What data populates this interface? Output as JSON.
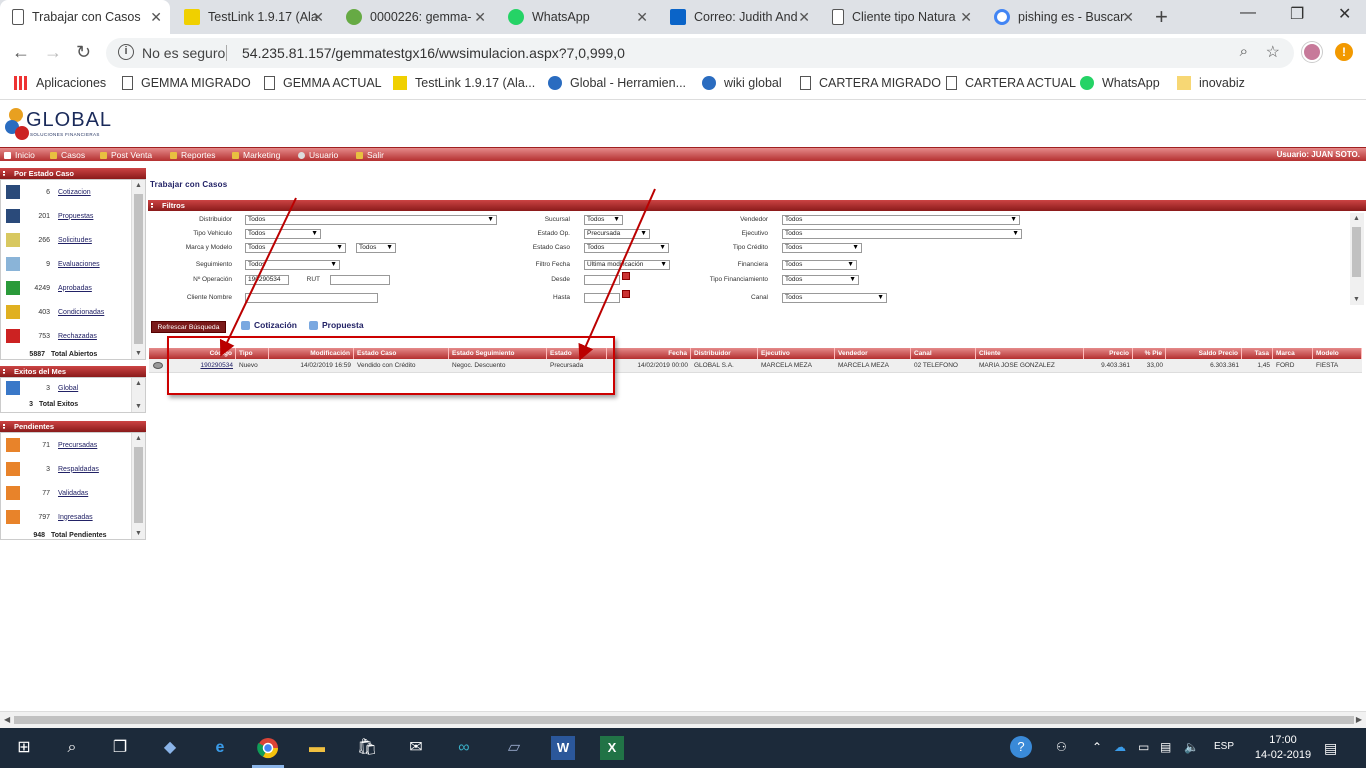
{
  "browser": {
    "tabs": [
      {
        "title": "Trabajar con Casos",
        "active": true,
        "icon": "page-icon"
      },
      {
        "title": "TestLink 1.9.17 (Ala",
        "icon": "testlink-icon"
      },
      {
        "title": "0000226: gemma-",
        "icon": "mantis-icon"
      },
      {
        "title": "WhatsApp",
        "icon": "whatsapp-icon"
      },
      {
        "title": "Correo: Judith And",
        "icon": "outlook-icon"
      },
      {
        "title": "Cliente tipo Natura",
        "icon": "page-icon"
      },
      {
        "title": "pishing es - Buscar",
        "icon": "google-icon"
      }
    ],
    "security_label": "No es seguro",
    "url": "54.235.81.157/gemmatestgx16/wwsimulacion.aspx?7,0,999,0",
    "bookmarks": [
      {
        "label": "Aplicaciones",
        "icon": "apps-icon"
      },
      {
        "label": "GEMMA MIGRADO",
        "icon": "page-icon"
      },
      {
        "label": "GEMMA ACTUAL",
        "icon": "page-icon"
      },
      {
        "label": "TestLink 1.9.17 (Ala...",
        "icon": "testlink-icon"
      },
      {
        "label": "Global - Herramien...",
        "icon": "global-icon"
      },
      {
        "label": "wiki global",
        "icon": "global-icon"
      },
      {
        "label": "CARTERA MIGRADO",
        "icon": "page-icon"
      },
      {
        "label": "CARTERA ACTUAL",
        "icon": "page-icon"
      },
      {
        "label": "WhatsApp",
        "icon": "whatsapp-icon"
      },
      {
        "label": "inovabiz",
        "icon": "folder-icon"
      }
    ]
  },
  "app": {
    "logo_text": "GLOBAL",
    "logo_sub": "SOLUCIONES FINANCIERAS",
    "menu": [
      "Inicio",
      "Casos",
      "Post Venta",
      "Reportes",
      "Marketing",
      "Usuario",
      "Salir"
    ],
    "user_label": "Usuario: JUAN SOTO."
  },
  "sidebar": {
    "por_estado": {
      "title": "Por Estado Caso",
      "items": [
        {
          "count": "6",
          "label": "Cotizacion"
        },
        {
          "count": "201",
          "label": "Propuestas"
        },
        {
          "count": "266",
          "label": "Solicitudes"
        },
        {
          "count": "9",
          "label": "Evaluaciones"
        },
        {
          "count": "4249",
          "label": "Aprobadas"
        },
        {
          "count": "403",
          "label": "Condicionadas"
        },
        {
          "count": "753",
          "label": "Rechazadas"
        }
      ],
      "total_count": "5887",
      "total_label": "Total Abiertos"
    },
    "exitos": {
      "title": "Exitos del Mes",
      "items": [
        {
          "count": "3",
          "label": "Global"
        }
      ],
      "total_count": "3",
      "total_label": "Total Exitos"
    },
    "pendientes": {
      "title": "Pendientes",
      "items": [
        {
          "count": "71",
          "label": "Precursadas"
        },
        {
          "count": "3",
          "label": "Respaldadas"
        },
        {
          "count": "77",
          "label": "Validadas"
        },
        {
          "count": "797",
          "label": "Ingresadas"
        }
      ],
      "total_count": "948",
      "total_label": "Total Pendientes"
    }
  },
  "page": {
    "title": "Trabajar con Casos",
    "filters_title": "Filtros",
    "filters": {
      "distribuidor": {
        "label": "Distribuidor",
        "value": "Todos"
      },
      "tipo_vehiculo": {
        "label": "Tipo Vehiculo",
        "value": "Todos"
      },
      "marca_modelo": {
        "label": "Marca y Modelo",
        "value": "Todos",
        "value2": "Todos"
      },
      "seguimiento": {
        "label": "Seguimiento",
        "value": "Todos"
      },
      "n_operacion": {
        "label": "Nº Operación",
        "value": "190290534"
      },
      "rut": {
        "label": "RUT",
        "value": ""
      },
      "cliente_nombre": {
        "label": "Cliente Nombre",
        "value": ""
      },
      "sucursal": {
        "label": "Sucursal",
        "value": "Todos"
      },
      "estado_op": {
        "label": "Estado Op.",
        "value": "Precursada"
      },
      "estado_caso": {
        "label": "Estado Caso",
        "value": "Todos"
      },
      "filtro_fecha": {
        "label": "Filtro Fecha",
        "value": "Ultima modificación"
      },
      "desde": {
        "label": "Desde",
        "value": ""
      },
      "hasta": {
        "label": "Hasta",
        "value": ""
      },
      "vendedor": {
        "label": "Vendedor",
        "value": "Todos"
      },
      "ejecutivo": {
        "label": "Ejecutivo",
        "value": "Todos"
      },
      "tipo_credito": {
        "label": "Tipo Crédito",
        "value": "Todos"
      },
      "financiera": {
        "label": "Financiera",
        "value": "Todos"
      },
      "tipo_financiamiento": {
        "label": "Tipo Financiamiento",
        "value": "Todos"
      },
      "canal": {
        "label": "Canal",
        "value": "Todos"
      }
    },
    "refresh_label": "Refrescar Búsqueda",
    "actions": [
      "Cotización",
      "Propuesta"
    ]
  },
  "table": {
    "headers": [
      "Código",
      "Tipo",
      "Modificación",
      "Estado Caso",
      "Estado Seguimiento",
      "Estado",
      "Fecha",
      "Distribuidor",
      "Ejecutivo",
      "Vendedor",
      "Canal",
      "Cliente",
      "Precio",
      "% Pie",
      "Saldo Precio",
      "Tasa",
      "Marca",
      "Modelo"
    ],
    "rows": [
      [
        "190290534",
        "Nuevo",
        "14/02/2019 16:59",
        "Vendido con Crédito",
        "Negoc. Descuento",
        "Precursada",
        "14/02/2019 00:00",
        "GLOBAL S.A.",
        "MARCELA MEZA",
        "MARCELA MEZA",
        "02 TELEFONO",
        "MARIA JOSE GONZALEZ",
        "9.403.361",
        "33,00",
        "6.303.361",
        "1,45",
        "FORD",
        "FIESTA"
      ]
    ]
  },
  "taskbar": {
    "lang": "ESP",
    "time": "17:00",
    "date": "14-02-2019"
  }
}
